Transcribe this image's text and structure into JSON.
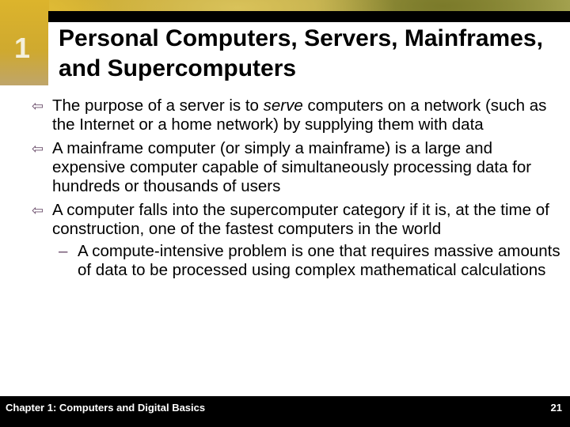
{
  "slide": {
    "chapter_number": "1",
    "title": "Personal Computers, Servers, Mainframes, and Supercomputers",
    "bullet_marker": "⇦",
    "sub_marker": "–",
    "bullets": [
      {
        "before": "The purpose of a server is to ",
        "emphasis": "serve",
        "after": " computers on a network (such as the Internet or a home network) by supplying them with data"
      },
      {
        "text": "A mainframe computer (or simply a mainframe) is a large and expensive computer capable of simultaneously processing data for hundreds or thousands of users"
      },
      {
        "text": "A computer falls into the supercomputer category if it is, at the time of construction, one of the fastest computers in the world",
        "sub": [
          {
            "text": "A compute-intensive problem is one that requires massive amounts of data to be processed using complex mathematical calculations"
          }
        ]
      }
    ]
  },
  "footer": {
    "chapter_label": "Chapter 1: Computers and Digital Basics",
    "page_number": "21"
  }
}
